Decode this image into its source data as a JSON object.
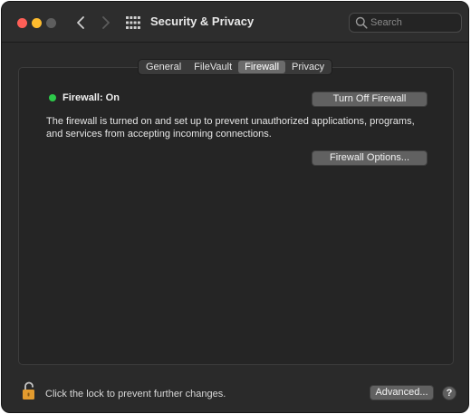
{
  "window": {
    "title": "Security & Privacy",
    "search_placeholder": "Search"
  },
  "tabs": [
    {
      "label": "General",
      "active": false
    },
    {
      "label": "FileVault",
      "active": false
    },
    {
      "label": "Firewall",
      "active": true
    },
    {
      "label": "Privacy",
      "active": false
    }
  ],
  "firewall": {
    "status_label": "Firewall: On",
    "status_color": "#2dc94a",
    "turn_off_label": "Turn Off Firewall",
    "description": "The firewall is turned on and set up to prevent unauthorized applications, programs, and services from accepting incoming connections.",
    "options_label": "Firewall Options..."
  },
  "footer": {
    "lock_text": "Click the lock to prevent further changes.",
    "advanced_label": "Advanced...",
    "help_label": "?"
  },
  "colors": {
    "close": "#fe5f57",
    "minimize": "#febc2e",
    "lock": "#e39b2e"
  },
  "icons": {
    "back": "chevron-left-icon",
    "forward": "chevron-right-icon",
    "grid": "grid-icon",
    "search": "search-icon",
    "lock": "lock-open-icon"
  }
}
